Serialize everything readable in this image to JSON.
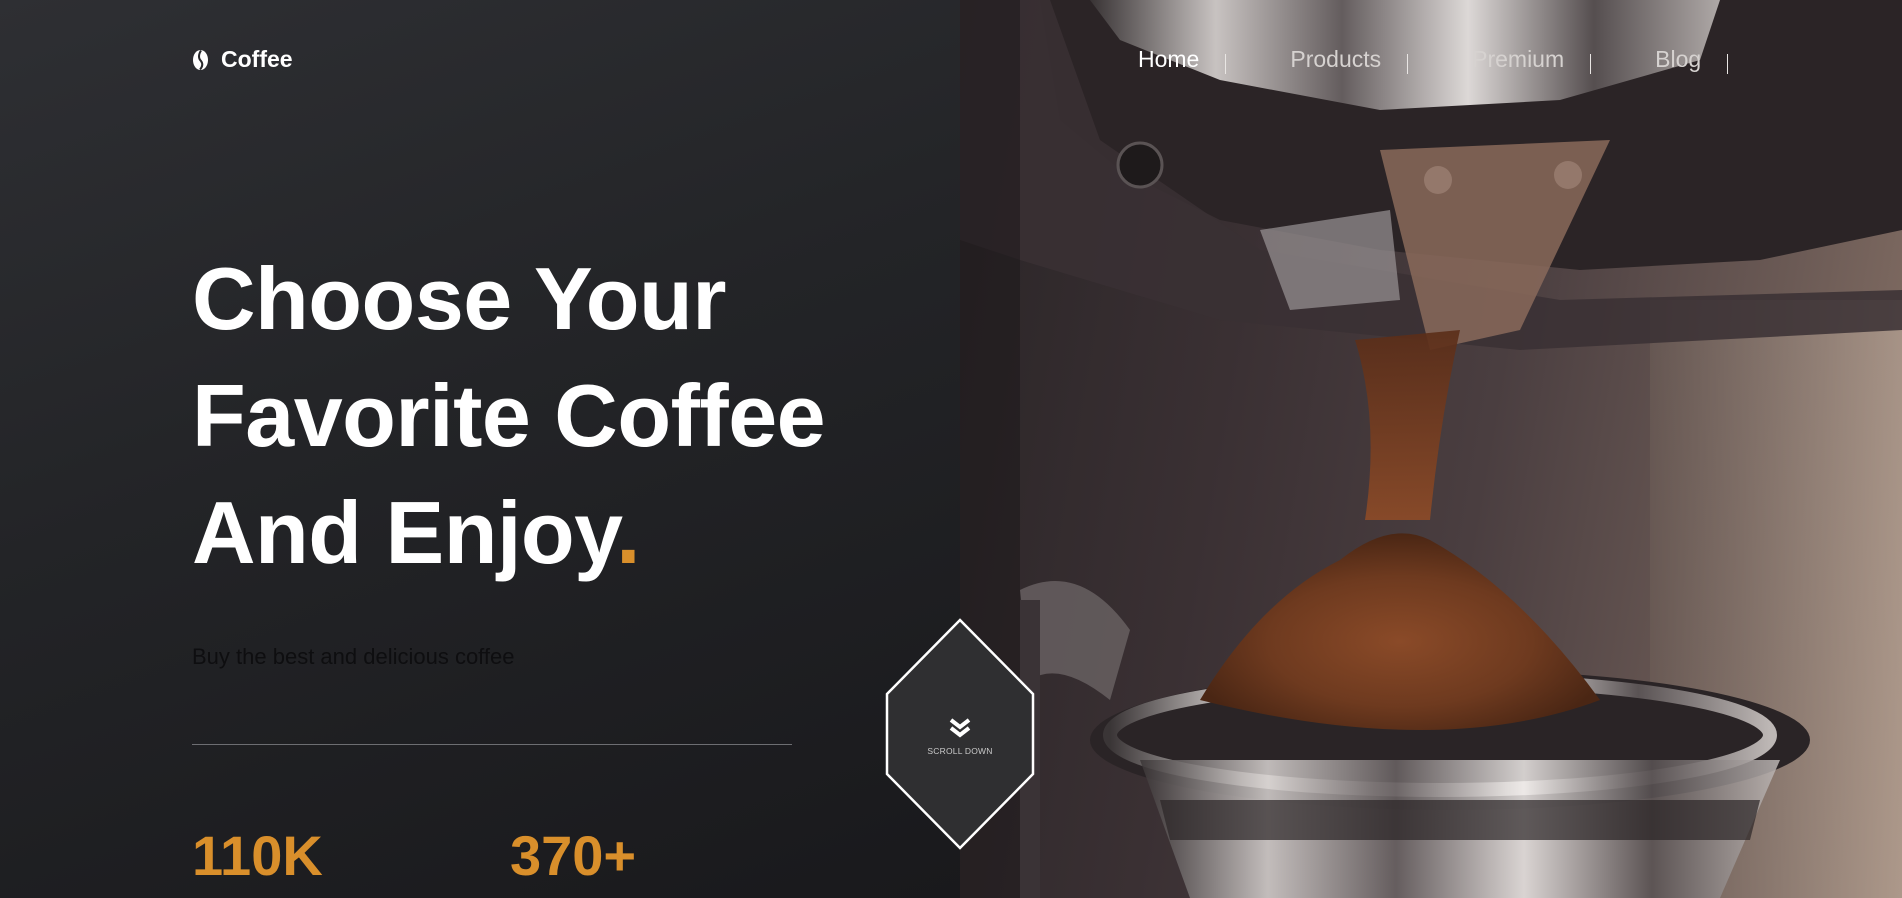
{
  "brand": {
    "name": "Coffee",
    "logo_icon": "coffee-bean-icon"
  },
  "nav": {
    "items": [
      {
        "label": "Home",
        "active": true
      },
      {
        "label": "Products",
        "active": false
      },
      {
        "label": "Premium",
        "active": false
      },
      {
        "label": "Blog",
        "active": false
      }
    ]
  },
  "hero": {
    "title_line_1": "Choose Your",
    "title_line_2": "Favorite Coffee",
    "title_line_3": "And Enjoy",
    "title_accent": ".",
    "subtitle": "Buy the best and delicious coffee"
  },
  "stats": [
    {
      "value": "110K"
    },
    {
      "value": "370+"
    }
  ],
  "scroll": {
    "label": "SCROLL DOWN",
    "icon": "double-chevron-down-icon"
  },
  "colors": {
    "accent": "#d98f2b",
    "background": "#1c1d20",
    "text": "#ffffff"
  }
}
